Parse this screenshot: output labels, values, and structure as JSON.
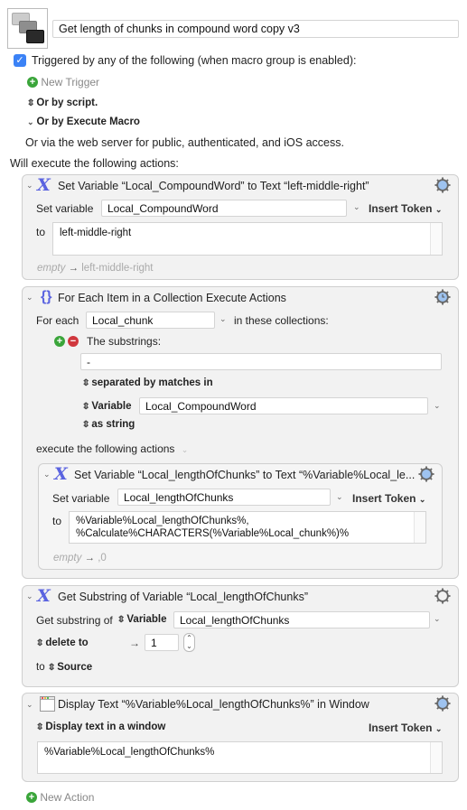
{
  "macro": {
    "name": "Get length of chunks in compound word copy v3",
    "icon": "macro-stack-icon"
  },
  "triggers": {
    "checkbox_checked": true,
    "heading": "Triggered by any of the following (when macro group is enabled):",
    "new_trigger": "New Trigger",
    "by_script": "Or by script.",
    "by_execute_macro": "Or by Execute Macro",
    "web_server": "Or via the web server for public, authenticated, and iOS access."
  },
  "actions_heading": "Will execute the following actions:",
  "actions": [
    {
      "title": "Set Variable “Local_CompoundWord” to Text “left-middle-right”",
      "icon": "variable-x-icon",
      "set_variable_label": "Set variable",
      "variable": "Local_CompoundWord",
      "insert_token": "Insert Token",
      "to_label": "to",
      "value": "left-middle-right",
      "preview_empty": "empty",
      "preview_arrow": "→",
      "preview_value": "left-middle-right"
    },
    {
      "title": "For Each Item in a Collection Execute Actions",
      "icon": "braces-icon",
      "for_each_label": "For each",
      "variable": "Local_chunk",
      "in_collections": "in these collections:",
      "substrings_label": "The substrings:",
      "separator": "-",
      "separated_by": "separated by matches in",
      "source_type": "Variable",
      "source_variable": "Local_CompoundWord",
      "as_string": "as string",
      "execute_label": "execute the following actions",
      "nested": {
        "title": "Set Variable “Local_lengthOfChunks” to Text “%Variable%Local_le...",
        "icon": "variable-x-icon",
        "set_variable_label": "Set variable",
        "variable": "Local_lengthOfChunks",
        "insert_token": "Insert Token",
        "to_label": "to",
        "value_line1": "%Variable%Local_lengthOfChunks%,",
        "value_line2": "%Calculate%CHARACTERS(%Variable%Local_chunk%)%",
        "preview_empty": "empty",
        "preview_arrow": "→",
        "preview_value": ",0"
      }
    },
    {
      "title": "Get Substring of Variable “Local_lengthOfChunks”",
      "icon": "variable-x-icon",
      "get_substring_label": "Get substring of",
      "source_type": "Variable",
      "variable": "Local_lengthOfChunks",
      "mode": "delete to",
      "arrow": "→",
      "count": "1",
      "to_label": "to",
      "destination": "Source"
    },
    {
      "title": "Display Text “%Variable%Local_lengthOfChunks%” in Window",
      "icon": "window-icon",
      "mode": "Display text in a window",
      "insert_token": "Insert Token",
      "value": "%Variable%Local_lengthOfChunks%"
    }
  ],
  "new_action": "New Action",
  "colors": {
    "accent_blue": "#3b82f6",
    "icon_purple": "#5a63e0",
    "add_green": "#3aa53a",
    "remove_red": "#d0373d",
    "gear_blue": "#9ec3f0"
  }
}
